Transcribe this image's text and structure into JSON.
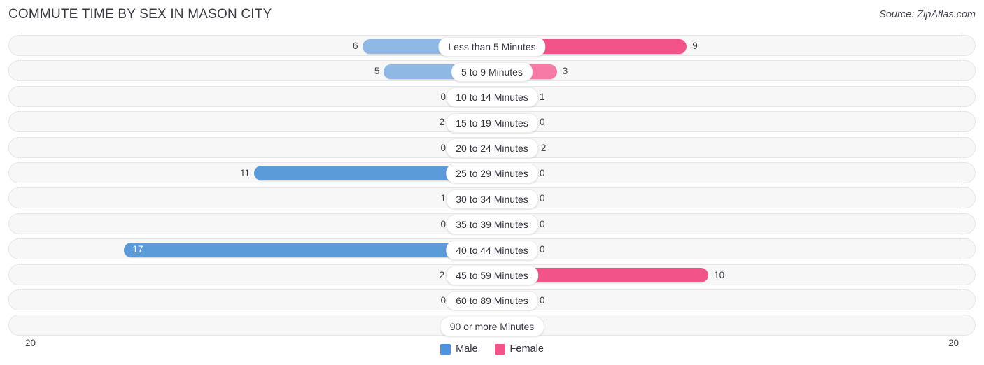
{
  "header": {
    "title": "COMMUTE TIME BY SEX IN MASON CITY",
    "source": "Source: ZipAtlas.com"
  },
  "axis": {
    "left_label": "20",
    "right_label": "20",
    "max": 20
  },
  "legend": {
    "items": [
      {
        "label": "Male",
        "color": "#4f93dd"
      },
      {
        "label": "Female",
        "color": "#f2548a"
      }
    ]
  },
  "colors": {
    "male_light": "#8fb8e5",
    "male_mid": "#7daee2",
    "male_dark": "#5b9bd9",
    "female_light": "#f9a8c3",
    "female_mid": "#f57aa6",
    "female_dark": "#f2548a",
    "track": "#f7f7f7",
    "track_border": "#e6e6e6",
    "grid": "#e3e3e3"
  },
  "chart_data": {
    "type": "bar",
    "orientation": "horizontal-diverging",
    "title": "COMMUTE TIME BY SEX IN MASON CITY",
    "xlabel": "",
    "ylabel": "",
    "xlim": [
      20,
      20
    ],
    "grid": true,
    "legend_position": "bottom",
    "categories": [
      "Less than 5 Minutes",
      "5 to 9 Minutes",
      "10 to 14 Minutes",
      "15 to 19 Minutes",
      "20 to 24 Minutes",
      "25 to 29 Minutes",
      "30 to 34 Minutes",
      "35 to 39 Minutes",
      "40 to 44 Minutes",
      "45 to 59 Minutes",
      "60 to 89 Minutes",
      "90 or more Minutes"
    ],
    "series": [
      {
        "name": "Male",
        "side": "left",
        "values": [
          6,
          5,
          0,
          2,
          0,
          11,
          1,
          0,
          17,
          2,
          0,
          0
        ]
      },
      {
        "name": "Female",
        "side": "right",
        "values": [
          9,
          3,
          1,
          0,
          2,
          0,
          0,
          0,
          0,
          10,
          0,
          0
        ]
      }
    ]
  }
}
